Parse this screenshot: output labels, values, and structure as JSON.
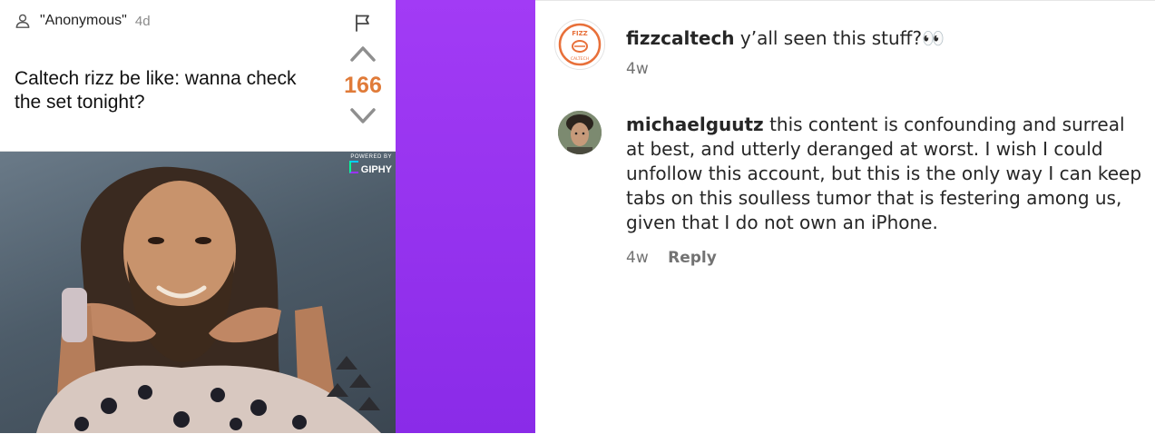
{
  "post": {
    "author": "\"Anonymous\"",
    "age": "4d",
    "text": "Caltech rizz be like: wanna check the set tonight?",
    "vote_count": "166",
    "gif_badge_small": "POWERED BY",
    "gif_badge_big": "GIPHY"
  },
  "comments": [
    {
      "username": "fizzcaltech",
      "text": "y’all seen this stuff?👀",
      "time": "4w",
      "avatar_text_top": "FIZZ",
      "avatar_text_bottom": "CALTECH"
    },
    {
      "username": "michaelguutz",
      "text": "this content is confounding and surreal at best, and utterly deranged at worst. I wish I could unfollow this account, but this is the only way I can keep tabs on this soulless tumor that is festering among us, given that I do not own an iPhone.",
      "time": "4w",
      "reply_label": "Reply"
    }
  ],
  "colors": {
    "vote_accent": "#e07b39",
    "purple": "#9b35f2",
    "fizz_orange": "#e8703a"
  },
  "icons": [
    "user-icon",
    "flag-icon",
    "chevron-up-icon",
    "chevron-down-icon",
    "giphy-logo"
  ]
}
